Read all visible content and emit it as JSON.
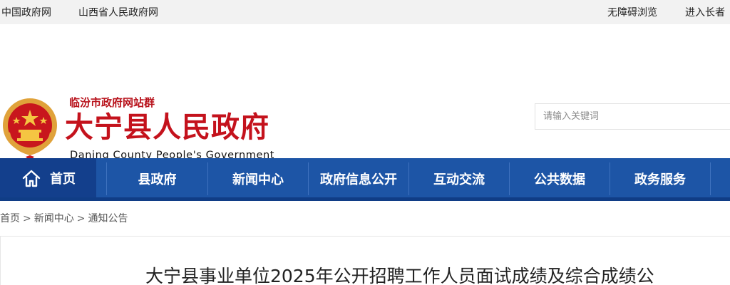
{
  "topbar": {
    "left_links": [
      "中国政府网",
      "山西省人民政府网"
    ],
    "right_links": [
      "无障碍浏览",
      "进入长者"
    ]
  },
  "header": {
    "site_group": "临汾市政府网站群",
    "title": "大宁县人民政府",
    "title_en": "Daning County People's Government",
    "emblem_icon": "national-emblem-icon",
    "title_color": "#c4121c"
  },
  "search": {
    "placeholder": "请输入关键词"
  },
  "nav": {
    "home_icon": "home-icon",
    "home_label": "首页",
    "items": [
      "县政府",
      "新闻中心",
      "政府信息公开",
      "互动交流",
      "公共数据",
      "政务服务"
    ],
    "bg_color": "#1d55a6"
  },
  "breadcrumb": {
    "items": [
      "首页",
      "新闻中心",
      "通知公告"
    ],
    "separator": ">"
  },
  "article": {
    "title": "大宁县事业单位2025年公开招聘工作人员面试成绩及综合成绩公"
  }
}
